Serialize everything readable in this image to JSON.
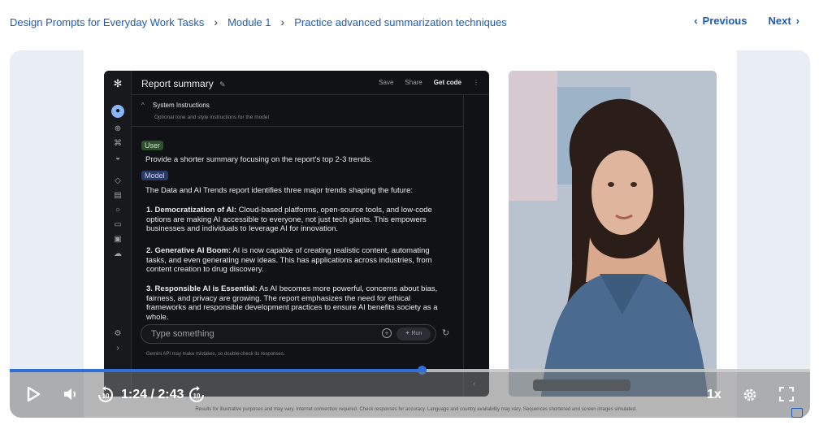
{
  "breadcrumb": {
    "items": [
      "Design Prompts for Everyday Work Tasks",
      "Module 1",
      "Practice advanced summarization techniques"
    ]
  },
  "nav": {
    "previous": "Previous",
    "next": "Next"
  },
  "app": {
    "title": "Report summary",
    "actions": {
      "save": "Save",
      "share": "Share",
      "get_code": "Get code"
    },
    "system_instructions": {
      "label": "System Instructions",
      "sub": "Optional tone and style instructions for the model"
    },
    "user_label": "User",
    "user_prompt": "Provide a shorter summary focusing on the report's top 2-3 trends.",
    "model_label": "Model",
    "model_intro": "The Data and AI Trends report identifies three major trends shaping the future:",
    "items": [
      {
        "title": "1. Democratization of AI:",
        "body": "Cloud-based platforms, open-source tools, and low-code options are making AI accessible to everyone, not just tech giants. This empowers businesses and individuals to leverage AI for innovation."
      },
      {
        "title": "2. Generative AI Boom:",
        "body": "AI is now capable of creating realistic content, automating tasks, and even generating new ideas. This has applications across industries, from content creation to drug discovery."
      },
      {
        "title": "3. Responsible AI is Essential:",
        "body": "As AI becomes more powerful, concerns about bias, fairness, and privacy are growing. The report emphasizes the need for ethical frameworks and responsible development practices to ensure AI benefits society as a whole."
      }
    ],
    "input_placeholder": "Type something",
    "run_label": "Run",
    "disclaimer": "Gemini API may make mistakes, so double-check its responses."
  },
  "player": {
    "current_time": "1:24",
    "duration": "2:43",
    "time_display": "1:24 / 2:43",
    "progress_fraction": 0.515,
    "speed": "1x",
    "skip_back_seconds": "10",
    "skip_fwd_seconds": "10"
  },
  "footnote": "Results for illustrative purposes and may vary. Internet connection required. Check responses for accuracy. Language and country availability may vary. Sequences shortened and screen images simulated.",
  "colors": {
    "link": "#1d5bb5",
    "progress": "#2f6fd6"
  }
}
